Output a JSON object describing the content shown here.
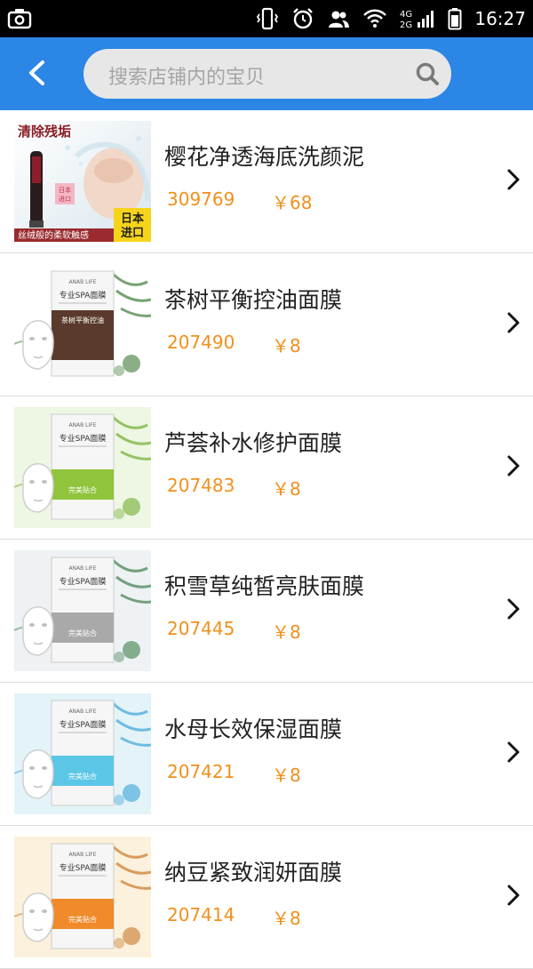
{
  "status_bar": {
    "time": "16:27",
    "icons": [
      "screenshot-icon",
      "vibrate-icon",
      "alarm-icon",
      "contacts-icon",
      "wifi-icon",
      "cellular-4g-2g-icon",
      "battery-icon"
    ]
  },
  "header": {
    "back_icon": "back-chevron-icon",
    "search_placeholder": "搜索店铺内的宝贝",
    "search_icon": "search-icon",
    "accent_color": "#2b86e6"
  },
  "products": [
    {
      "title": "樱花净透海底洗颜泥",
      "code": "309769",
      "price": "￥68",
      "image": {
        "type": "cleanser",
        "top_text": "清除残垢",
        "bottom_text": "丝绒般的柔软触感",
        "badge_text_1": "日本",
        "badge_text_2": "进口",
        "label_text": "日本进口"
      }
    },
    {
      "title": "茶树平衡控油面膜",
      "code": "207490",
      "price": "￥8",
      "image": {
        "type": "mask",
        "brand": "ANAB LIFE",
        "name": "专业SPA面膜",
        "band": "茶树平衡控油",
        "band_color": "#5a3a2c",
        "bg": "#ffffff",
        "accent": "#3c7a36"
      }
    },
    {
      "title": "芦荟补水修护面膜",
      "code": "207483",
      "price": "￥8",
      "image": {
        "type": "mask",
        "brand": "ANAB LIFE",
        "name": "专业SPA面膜",
        "band": "完美贴合",
        "band_color": "#8fc43c",
        "bg": "#eef6e4",
        "accent": "#6fae2e"
      }
    },
    {
      "title": "积雪草纯皙亮肤面膜",
      "code": "207445",
      "price": "￥8",
      "image": {
        "type": "mask",
        "brand": "ANAB LIFE",
        "name": "专业SPA面膜",
        "band": "完美贴合",
        "band_color": "#a9a9a9",
        "bg": "#eef2f4",
        "accent": "#3e7e4a"
      }
    },
    {
      "title": "水母长效保湿面膜",
      "code": "207421",
      "price": "￥8",
      "image": {
        "type": "mask",
        "brand": "ANAB LIFE",
        "name": "专业SPA面膜",
        "band": "完美贴合",
        "band_color": "#5cc6e6",
        "bg": "#e4f3f8",
        "accent": "#3ba4d6"
      }
    },
    {
      "title": "纳豆紧致润妍面膜",
      "code": "207414",
      "price": "￥8",
      "image": {
        "type": "mask",
        "brand": "ANAB LIFE",
        "name": "专业SPA面膜",
        "band": "完美贴合",
        "band_color": "#f08a2a",
        "bg": "#fbf1dc",
        "accent": "#c9772a"
      }
    }
  ]
}
